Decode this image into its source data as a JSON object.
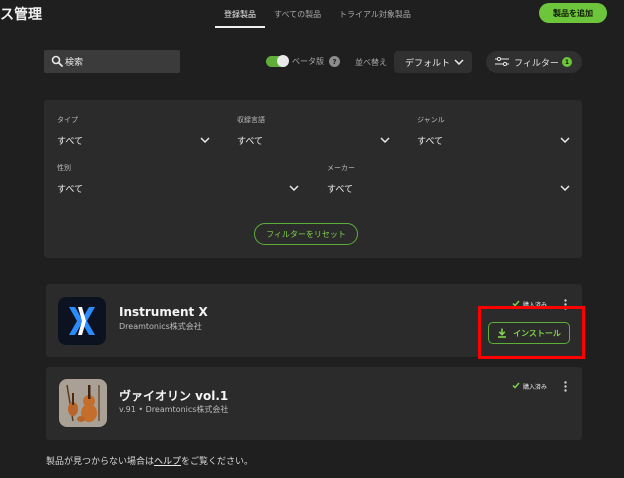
{
  "header": {
    "title": "ス管理",
    "tabs": [
      {
        "label": "登録製品",
        "active": true
      },
      {
        "label": "すべての製品",
        "active": false
      },
      {
        "label": "トライアル対象製品",
        "active": false
      }
    ],
    "add_button": "製品を追加"
  },
  "toolbar": {
    "search_placeholder": "検索",
    "beta_label": "ベータ版",
    "help_glyph": "?",
    "sort_label": "並べ替え",
    "sort_value": "デフォルト",
    "filter_label": "フィルター",
    "filter_count": "1"
  },
  "filters": {
    "type": {
      "label": "タイプ",
      "value": "すべて"
    },
    "language": {
      "label": "収録言語",
      "value": "すべて"
    },
    "genre": {
      "label": "ジャンル",
      "value": "すべて"
    },
    "gender": {
      "label": "性別",
      "value": "すべて"
    },
    "maker": {
      "label": "メーカー",
      "value": "すべて"
    },
    "reset_button": "フィルターをリセット"
  },
  "products": [
    {
      "name": "Instrument X",
      "vendor": "Dreamtonics株式会社",
      "status": "購入済み",
      "action": "インストール"
    },
    {
      "name": "ヴァイオリン vol.1",
      "vendor": "v.91 • Dreamtonics株式会社",
      "status": "購入済み"
    }
  ],
  "footer": {
    "prefix": "製品が見つからない場合は",
    "link": "ヘルプ",
    "suffix": "をご覧ください。"
  },
  "colors": {
    "accent": "#6cc53a",
    "background": "#1f1f1f",
    "panel": "#2b2b2b",
    "highlight": "#ff0000"
  }
}
